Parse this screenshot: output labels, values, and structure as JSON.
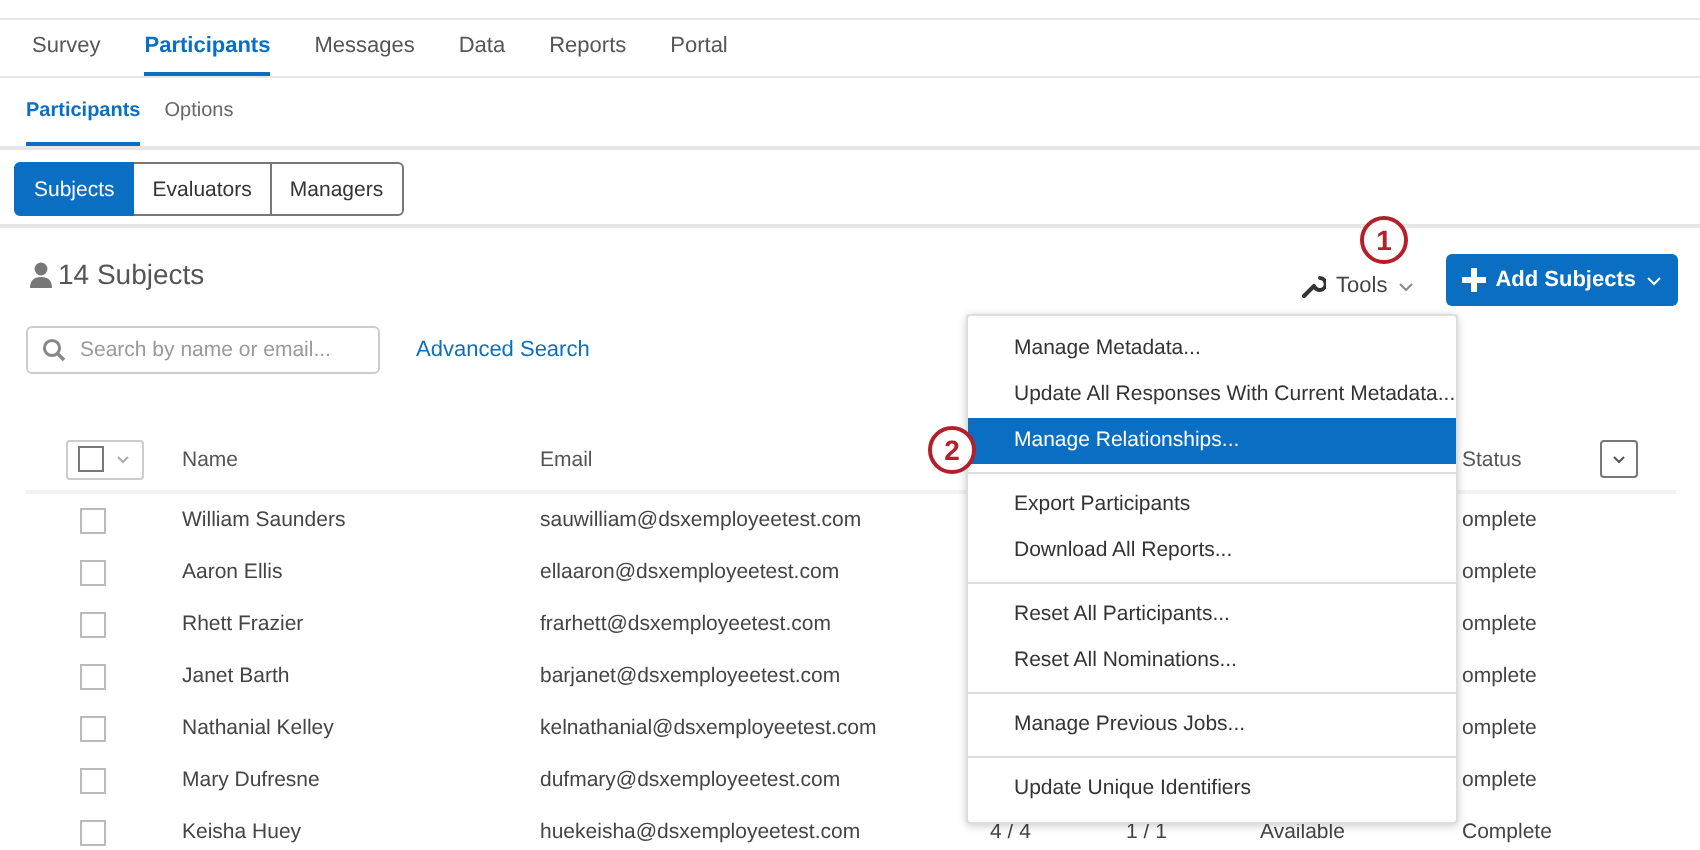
{
  "nav_tabs": [
    {
      "label": "Survey",
      "selected": false
    },
    {
      "label": "Participants",
      "selected": true
    },
    {
      "label": "Messages",
      "selected": false
    },
    {
      "label": "Data",
      "selected": false
    },
    {
      "label": "Reports",
      "selected": false
    },
    {
      "label": "Portal",
      "selected": false
    }
  ],
  "sub_tabs": [
    {
      "label": "Participants",
      "selected": true
    },
    {
      "label": "Options",
      "selected": false
    }
  ],
  "segments": [
    {
      "label": "Subjects",
      "selected": true
    },
    {
      "label": "Evaluators",
      "selected": false
    },
    {
      "label": "Managers",
      "selected": false
    }
  ],
  "count": "14 Subjects",
  "tools_button": "Tools",
  "add_button": "Add Subjects",
  "search": {
    "placeholder": "Search by name or email..."
  },
  "advanced_search": "Advanced Search",
  "table": {
    "select_all_checked": false,
    "columns": [
      "Name",
      "Email",
      "Status"
    ],
    "rows": [
      {
        "checked": false,
        "name": "William Saunders",
        "email": "sauwilliam@dsxemployeetest.com",
        "status": "omplete"
      },
      {
        "checked": false,
        "name": "Aaron Ellis",
        "email": "ellaaron@dsxemployeetest.com",
        "status": "omplete"
      },
      {
        "checked": false,
        "name": "Rhett Frazier",
        "email": "frarhett@dsxemployeetest.com",
        "status": "omplete"
      },
      {
        "checked": false,
        "name": "Janet Barth",
        "email": "barjanet@dsxemployeetest.com",
        "status": "omplete"
      },
      {
        "checked": false,
        "name": "Nathanial Kelley",
        "email": "kelnathanial@dsxemployeetest.com",
        "status": "omplete"
      },
      {
        "checked": false,
        "name": "Mary Dufresne",
        "email": "dufmary@dsxemployeetest.com",
        "status": "omplete"
      },
      {
        "checked": false,
        "name": "Keisha Huey",
        "email": "huekeisha@dsxemployeetest.com",
        "column_3": "4 / 4",
        "column_4": "1 / 1",
        "column_5": "Available",
        "status": "Complete"
      }
    ]
  },
  "tools_menu": {
    "groups": [
      [
        {
          "label": "Manage Metadata...",
          "selected": false
        },
        {
          "label": "Update All Responses With Current Metadata...",
          "selected": false
        },
        {
          "label": "Manage Relationships...",
          "selected": true
        }
      ],
      [
        {
          "label": "Export Participants",
          "selected": false
        },
        {
          "label": "Download All Reports...",
          "selected": false
        }
      ],
      [
        {
          "label": "Reset All Participants...",
          "selected": false
        },
        {
          "label": "Reset All Nominations...",
          "selected": false
        }
      ],
      [
        {
          "label": "Manage Previous Jobs...",
          "selected": false
        }
      ],
      [
        {
          "label": "Update Unique Identifiers",
          "selected": false
        }
      ]
    ]
  },
  "callouts": [
    "1",
    "2"
  ]
}
